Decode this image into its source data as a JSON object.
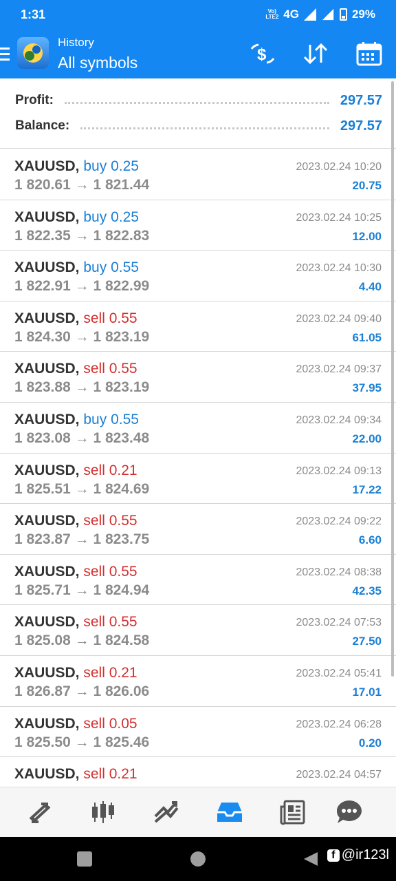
{
  "status_bar": {
    "time": "1:31",
    "volte": "Vo) LTE2",
    "network": "4G",
    "battery": "29%"
  },
  "app_bar": {
    "subtitle": "History",
    "title": "All symbols",
    "accent": "#1487f2"
  },
  "summary": {
    "profit_label": "Profit:",
    "profit_value": "297.57",
    "balance_label": "Balance:",
    "balance_value": "297.57"
  },
  "trades": [
    {
      "symbol": "XAUUSD,",
      "side": "buy",
      "volume": "0.25",
      "open": "1 820.61",
      "close": "1 821.44",
      "datetime": "2023.02.24 10:20",
      "profit": "20.75"
    },
    {
      "symbol": "XAUUSD,",
      "side": "buy",
      "volume": "0.25",
      "open": "1 822.35",
      "close": "1 822.83",
      "datetime": "2023.02.24 10:25",
      "profit": "12.00"
    },
    {
      "symbol": "XAUUSD,",
      "side": "buy",
      "volume": "0.55",
      "open": "1 822.91",
      "close": "1 822.99",
      "datetime": "2023.02.24 10:30",
      "profit": "4.40"
    },
    {
      "symbol": "XAUUSD,",
      "side": "sell",
      "volume": "0.55",
      "open": "1 824.30",
      "close": "1 823.19",
      "datetime": "2023.02.24 09:40",
      "profit": "61.05"
    },
    {
      "symbol": "XAUUSD,",
      "side": "sell",
      "volume": "0.55",
      "open": "1 823.88",
      "close": "1 823.19",
      "datetime": "2023.02.24 09:37",
      "profit": "37.95"
    },
    {
      "symbol": "XAUUSD,",
      "side": "buy",
      "volume": "0.55",
      "open": "1 823.08",
      "close": "1 823.48",
      "datetime": "2023.02.24 09:34",
      "profit": "22.00"
    },
    {
      "symbol": "XAUUSD,",
      "side": "sell",
      "volume": "0.21",
      "open": "1 825.51",
      "close": "1 824.69",
      "datetime": "2023.02.24 09:13",
      "profit": "17.22"
    },
    {
      "symbol": "XAUUSD,",
      "side": "sell",
      "volume": "0.55",
      "open": "1 823.87",
      "close": "1 823.75",
      "datetime": "2023.02.24 09:22",
      "profit": "6.60"
    },
    {
      "symbol": "XAUUSD,",
      "side": "sell",
      "volume": "0.55",
      "open": "1 825.71",
      "close": "1 824.94",
      "datetime": "2023.02.24 08:38",
      "profit": "42.35"
    },
    {
      "symbol": "XAUUSD,",
      "side": "sell",
      "volume": "0.55",
      "open": "1 825.08",
      "close": "1 824.58",
      "datetime": "2023.02.24 07:53",
      "profit": "27.50"
    },
    {
      "symbol": "XAUUSD,",
      "side": "sell",
      "volume": "0.21",
      "open": "1 826.87",
      "close": "1 826.06",
      "datetime": "2023.02.24 05:41",
      "profit": "17.01"
    },
    {
      "symbol": "XAUUSD,",
      "side": "sell",
      "volume": "0.05",
      "open": "1 825.50",
      "close": "1 825.46",
      "datetime": "2023.02.24 06:28",
      "profit": "0.20"
    },
    {
      "symbol": "XAUUSD,",
      "side": "sell",
      "volume": "0.21",
      "open": "",
      "close": "",
      "datetime": "2023.02.24 04:57",
      "profit": ""
    }
  ],
  "price_arrow": "→",
  "bottom_nav": [
    "quotes-icon",
    "chart-icon",
    "trade-icon",
    "history-icon",
    "news-icon",
    "chat-icon"
  ],
  "colors": {
    "buy": "#1a7fd4",
    "sell": "#d32f2f",
    "active_nav": "#1a8cf0"
  },
  "watermark": "@ir123l"
}
